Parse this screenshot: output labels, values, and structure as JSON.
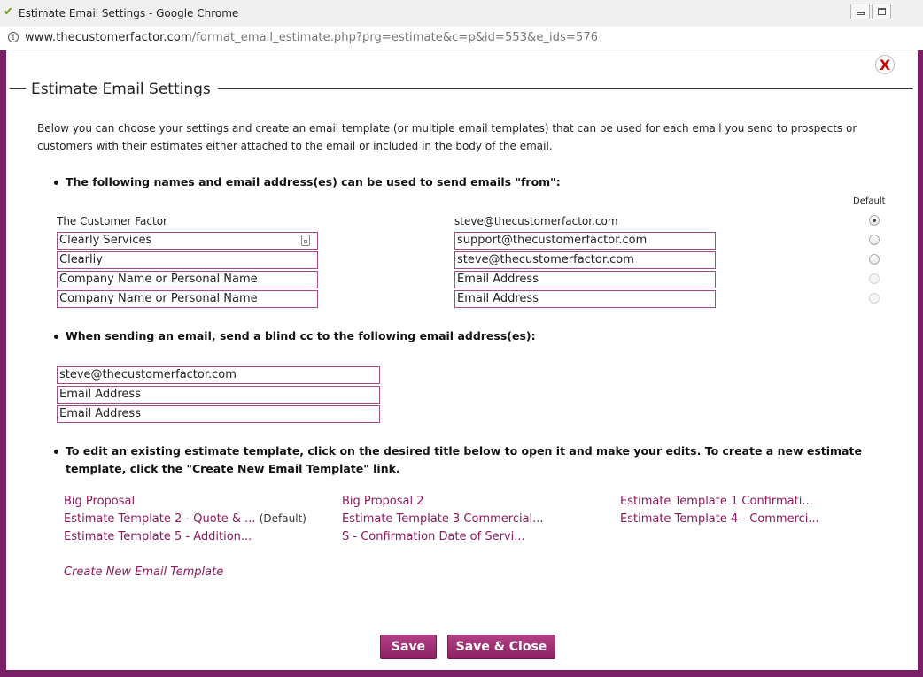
{
  "window": {
    "title": "Estimate Email Settings - Google Chrome",
    "url_host": "www.thecustomerfactor.com",
    "url_path": "/format_email_estimate.php?prg=estimate&c=p&id=553&e_ids=576"
  },
  "dialog": {
    "close_label": "X",
    "heading": "Estimate Email Settings",
    "intro": "Below you can choose your settings and create an email template (or multiple email templates) that can be used for each email you send to prospects or customers with their estimates either attached to the email or included in the body of the email."
  },
  "senders": {
    "heading": "The following names and email address(es) can be used to send emails \"from\":",
    "default_label": "Default",
    "primary_name": "The Customer Factor",
    "primary_email": "steve@thecustomerfactor.com",
    "rows": [
      {
        "name": "Clearly Services",
        "email": "support@thecustomerfactor.com"
      },
      {
        "name": "Clearliy",
        "email": "steve@thecustomerfactor.com"
      },
      {
        "name": "Company Name or Personal Name",
        "email": "Email Address"
      },
      {
        "name": "Company Name or Personal Name",
        "email": "Email Address"
      }
    ]
  },
  "bcc": {
    "heading": "When sending an email, send a blind cc to the following email address(es):",
    "fields": [
      "steve@thecustomerfactor.com",
      "Email Address",
      "Email Address"
    ]
  },
  "templates": {
    "heading": "To edit an existing estimate template, click on the desired title below to open it and make your edits. To create a new estimate template, click the \"Create New Email Template\" link.",
    "links": [
      "Big Proposal",
      "Big Proposal 2",
      "Estimate Template 1 Confirmati...",
      "Estimate Template 2 - Quote & ...",
      "Estimate Template 3 Commercial...",
      "Estimate Template 4 - Commerci...",
      "Estimate Template 5 - Addition...",
      "S - Confirmation Date of Servi..."
    ],
    "default_suffix": "(Default)",
    "create_label": "Create New Email Template"
  },
  "buttons": {
    "save": "Save",
    "save_close": "Save & Close"
  }
}
